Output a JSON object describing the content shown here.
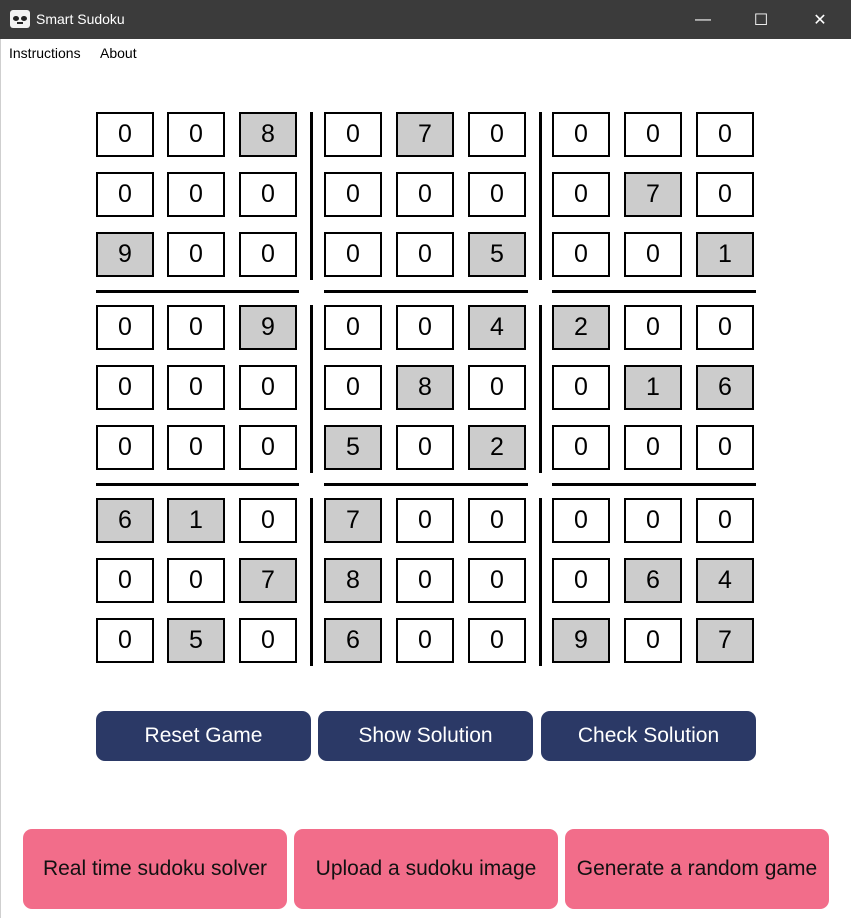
{
  "window": {
    "title": "Smart Sudoku",
    "icon": "cat-mask-icon",
    "controls": {
      "minimize": "—",
      "maximize": "☐",
      "close": "✕"
    }
  },
  "menu": {
    "items": [
      "Instructions",
      "About"
    ]
  },
  "board": {
    "values": [
      [
        0,
        0,
        8,
        0,
        7,
        0,
        0,
        0,
        0
      ],
      [
        0,
        0,
        0,
        0,
        0,
        0,
        0,
        7,
        0
      ],
      [
        9,
        0,
        0,
        0,
        0,
        5,
        0,
        0,
        1
      ],
      [
        0,
        0,
        9,
        0,
        0,
        4,
        2,
        0,
        0
      ],
      [
        0,
        0,
        0,
        0,
        8,
        0,
        0,
        1,
        6
      ],
      [
        0,
        0,
        0,
        5,
        0,
        2,
        0,
        0,
        0
      ],
      [
        6,
        1,
        0,
        7,
        0,
        0,
        0,
        0,
        0
      ],
      [
        0,
        0,
        7,
        8,
        0,
        0,
        0,
        6,
        4
      ],
      [
        0,
        5,
        0,
        6,
        0,
        0,
        9,
        0,
        7
      ]
    ],
    "given_color": "#cccccc",
    "empty_color": "#ffffff"
  },
  "controls": {
    "reset": "Reset Game",
    "show": "Show Solution",
    "check": "Check Solution"
  },
  "modes": {
    "realtime": "Real time sudoku solver",
    "upload": "Upload a sudoku image",
    "generate": "Generate a random game"
  },
  "colors": {
    "titlebar": "#3b3b3b",
    "primary_button": "#2b3966",
    "secondary_button": "#f26d8a"
  }
}
